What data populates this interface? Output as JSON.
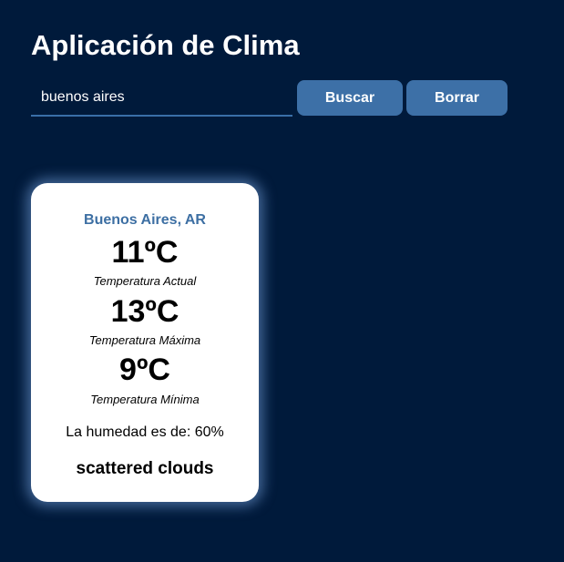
{
  "header": {
    "title": "Aplicación de Clima"
  },
  "search": {
    "value": "buenos aires",
    "search_label": "Buscar",
    "clear_label": "Borrar"
  },
  "weather": {
    "city": "Buenos Aires, AR",
    "current_temp": "11ºC",
    "current_label": "Temperatura Actual",
    "max_temp": "13ºC",
    "max_label": "Temperatura Máxima",
    "min_temp": "9ºC",
    "min_label": "Temperatura Mínima",
    "humidity_text": "La humedad es de: 60%",
    "description": "scattered clouds"
  },
  "colors": {
    "background": "#001a3b",
    "accent": "#3d70a7",
    "city_text": "#3d6fa3",
    "card": "#ffffff"
  }
}
